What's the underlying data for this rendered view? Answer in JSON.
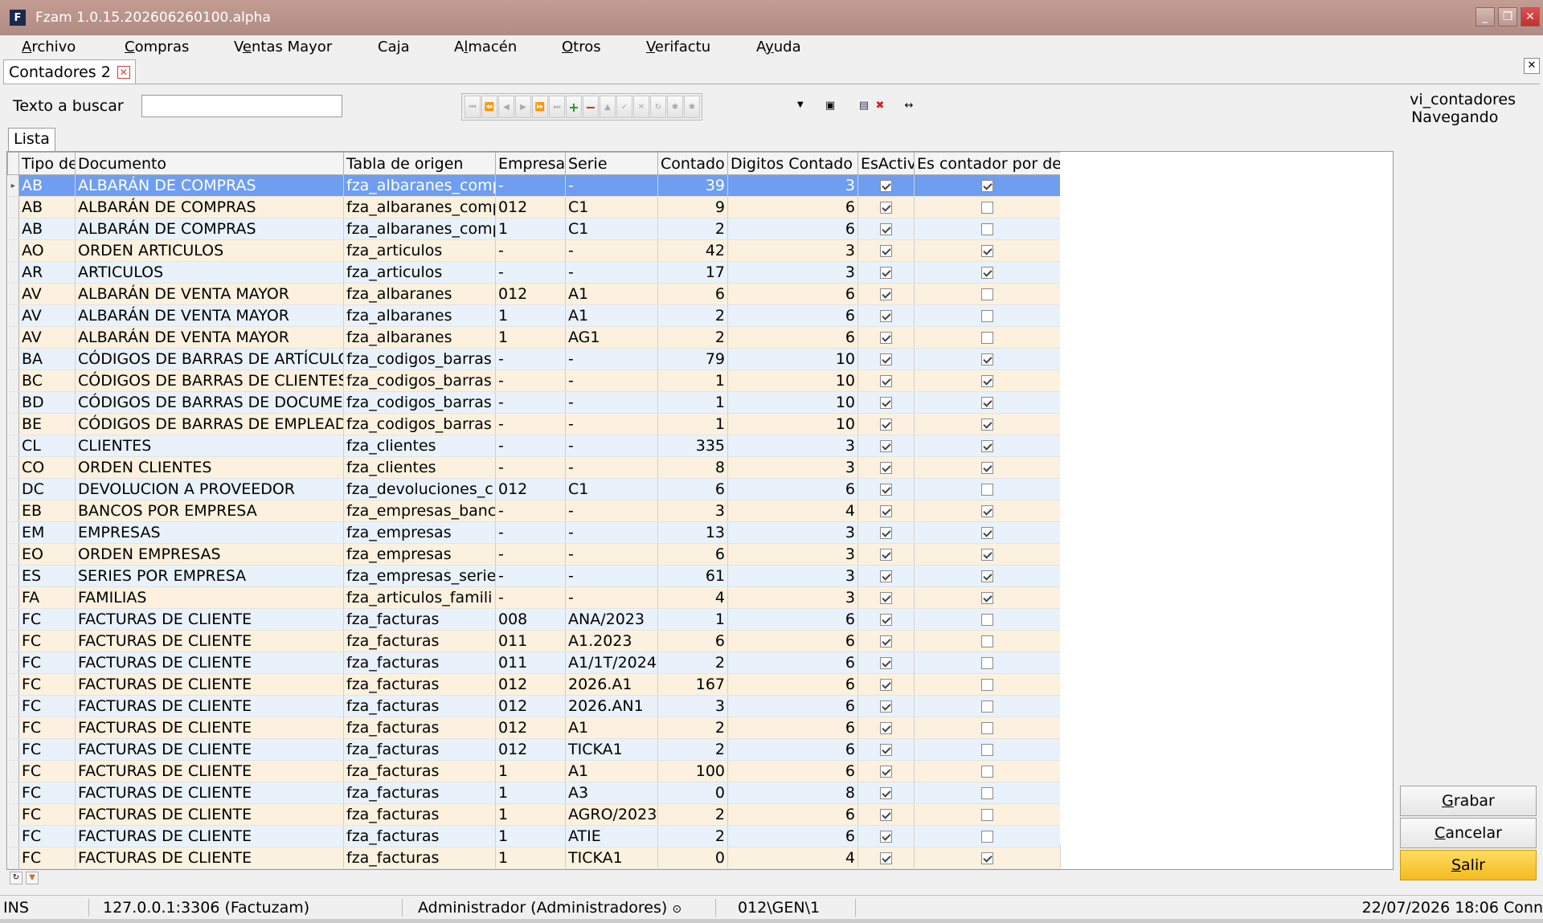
{
  "window": {
    "title": "Fzam 1.0.15.202606260100.alpha",
    "icon_letter": "F"
  },
  "menu": [
    {
      "pre": "",
      "u": "A",
      "post": "rchivo"
    },
    {
      "pre": "",
      "u": "C",
      "post": "ompras"
    },
    {
      "pre": "V",
      "u": "e",
      "post": "ntas Mayor"
    },
    {
      "pre": "Ca",
      "u": "j",
      "post": "a"
    },
    {
      "pre": "A",
      "u": "l",
      "post": "macén"
    },
    {
      "pre": "",
      "u": "O",
      "post": "tros"
    },
    {
      "pre": "",
      "u": "V",
      "post": "erifactu"
    },
    {
      "pre": "A",
      "u": "y",
      "post": "uda"
    }
  ],
  "doc_tab": {
    "label": "Contadores 2"
  },
  "search": {
    "label": "Texto a buscar",
    "value": ""
  },
  "status_panel": {
    "view": "vi_contadores",
    "mode": "Navegando"
  },
  "inner_tab": {
    "label": "Lista"
  },
  "grid": {
    "columns": [
      "Tipo de",
      "Documento",
      "Tabla de origen",
      "Empresa",
      "Serie",
      "Contado",
      "Digitos Contado",
      "EsActiv",
      "Es contador por de"
    ],
    "rows": [
      [
        "AB",
        "ALBARÁN DE COMPRAS",
        "fza_albaranes_comp",
        "-",
        "-",
        "39",
        "3",
        true,
        true
      ],
      [
        "AB",
        "ALBARÁN DE COMPRAS",
        "fza_albaranes_comp",
        "012",
        "C1",
        "9",
        "6",
        true,
        false
      ],
      [
        "AB",
        "ALBARÁN DE COMPRAS",
        "fza_albaranes_comp",
        "1",
        "C1",
        "2",
        "6",
        true,
        false
      ],
      [
        "AO",
        "ORDEN ARTICULOS",
        "fza_articulos",
        "-",
        "-",
        "42",
        "3",
        true,
        true
      ],
      [
        "AR",
        "ARTICULOS",
        "fza_articulos",
        "-",
        "-",
        "17",
        "3",
        true,
        true
      ],
      [
        "AV",
        "ALBARÁN DE VENTA MAYOR",
        "fza_albaranes",
        "012",
        "A1",
        "6",
        "6",
        true,
        false
      ],
      [
        "AV",
        "ALBARÁN DE VENTA MAYOR",
        "fza_albaranes",
        "1",
        "A1",
        "2",
        "6",
        true,
        false
      ],
      [
        "AV",
        "ALBARÁN DE VENTA MAYOR",
        "fza_albaranes",
        "1",
        "AG1",
        "2",
        "6",
        true,
        false
      ],
      [
        "BA",
        "CÓDIGOS DE BARRAS DE ARTÍCULOS",
        "fza_codigos_barras",
        "-",
        "-",
        "79",
        "10",
        true,
        true
      ],
      [
        "BC",
        "CÓDIGOS DE BARRAS DE CLIENTES",
        "fza_codigos_barras",
        "-",
        "-",
        "1",
        "10",
        true,
        true
      ],
      [
        "BD",
        "CÓDIGOS DE BARRAS DE DOCUMENTOS",
        "fza_codigos_barras",
        "-",
        "-",
        "1",
        "10",
        true,
        true
      ],
      [
        "BE",
        "CÓDIGOS DE BARRAS DE EMPLEADOS",
        "fza_codigos_barras",
        "-",
        "-",
        "1",
        "10",
        true,
        true
      ],
      [
        "CL",
        "CLIENTES",
        "fza_clientes",
        "-",
        "-",
        "335",
        "3",
        true,
        true
      ],
      [
        "CO",
        "ORDEN CLIENTES",
        "fza_clientes",
        "-",
        "-",
        "8",
        "3",
        true,
        true
      ],
      [
        "DC",
        "DEVOLUCION A PROVEEDOR",
        "fza_devoluciones_c",
        "012",
        "C1",
        "6",
        "6",
        true,
        false
      ],
      [
        "EB",
        "BANCOS POR EMPRESA",
        "fza_empresas_banco",
        "-",
        "-",
        "3",
        "4",
        true,
        true
      ],
      [
        "EM",
        "EMPRESAS",
        "fza_empresas",
        "-",
        "-",
        "13",
        "3",
        true,
        true
      ],
      [
        "EO",
        "ORDEN EMPRESAS",
        "fza_empresas",
        "-",
        "-",
        "6",
        "3",
        true,
        true
      ],
      [
        "ES",
        "SERIES POR EMPRESA",
        "fza_empresas_series",
        "-",
        "-",
        "61",
        "3",
        true,
        true
      ],
      [
        "FA",
        "FAMILIAS",
        "fza_articulos_famili",
        "-",
        "-",
        "4",
        "3",
        true,
        true
      ],
      [
        "FC",
        "FACTURAS DE CLIENTE",
        "fza_facturas",
        "008",
        "ANA/2023",
        "1",
        "6",
        true,
        false
      ],
      [
        "FC",
        "FACTURAS DE CLIENTE",
        "fza_facturas",
        "011",
        "A1.2023",
        "6",
        "6",
        true,
        false
      ],
      [
        "FC",
        "FACTURAS DE CLIENTE",
        "fza_facturas",
        "011",
        "A1/1T/2024",
        "2",
        "6",
        true,
        false
      ],
      [
        "FC",
        "FACTURAS DE CLIENTE",
        "fza_facturas",
        "012",
        "2026.A1",
        "167",
        "6",
        true,
        false
      ],
      [
        "FC",
        "FACTURAS DE CLIENTE",
        "fza_facturas",
        "012",
        "2026.AN1",
        "3",
        "6",
        true,
        false
      ],
      [
        "FC",
        "FACTURAS DE CLIENTE",
        "fza_facturas",
        "012",
        "A1",
        "2",
        "6",
        true,
        false
      ],
      [
        "FC",
        "FACTURAS DE CLIENTE",
        "fza_facturas",
        "012",
        "TICKA1",
        "2",
        "6",
        true,
        false
      ],
      [
        "FC",
        "FACTURAS DE CLIENTE",
        "fza_facturas",
        "1",
        "A1",
        "100",
        "6",
        true,
        false
      ],
      [
        "FC",
        "FACTURAS DE CLIENTE",
        "fza_facturas",
        "1",
        "A3",
        "0",
        "8",
        true,
        false
      ],
      [
        "FC",
        "FACTURAS DE CLIENTE",
        "fza_facturas",
        "1",
        "AGRO/2023",
        "2",
        "6",
        true,
        false
      ],
      [
        "FC",
        "FACTURAS DE CLIENTE",
        "fza_facturas",
        "1",
        "ATIE",
        "2",
        "6",
        true,
        false
      ],
      [
        "FC",
        "FACTURAS DE CLIENTE",
        "fza_facturas",
        "1",
        "TICKA1",
        "0",
        "4",
        true,
        true
      ]
    ],
    "selected_row": 0
  },
  "buttons": {
    "save": {
      "u": "G",
      "rest": "rabar"
    },
    "cancel": {
      "u": "C",
      "rest": "ancelar"
    },
    "exit": {
      "u": "S",
      "rest": "alir"
    }
  },
  "statusbar": {
    "mode": "INS",
    "connection": "127.0.0.1:3306 (Factuzam)",
    "user": "Administrador (Administradores)",
    "path": "012\\GEN\\1",
    "datetime": "22/07/2026 18:06 Conn"
  }
}
